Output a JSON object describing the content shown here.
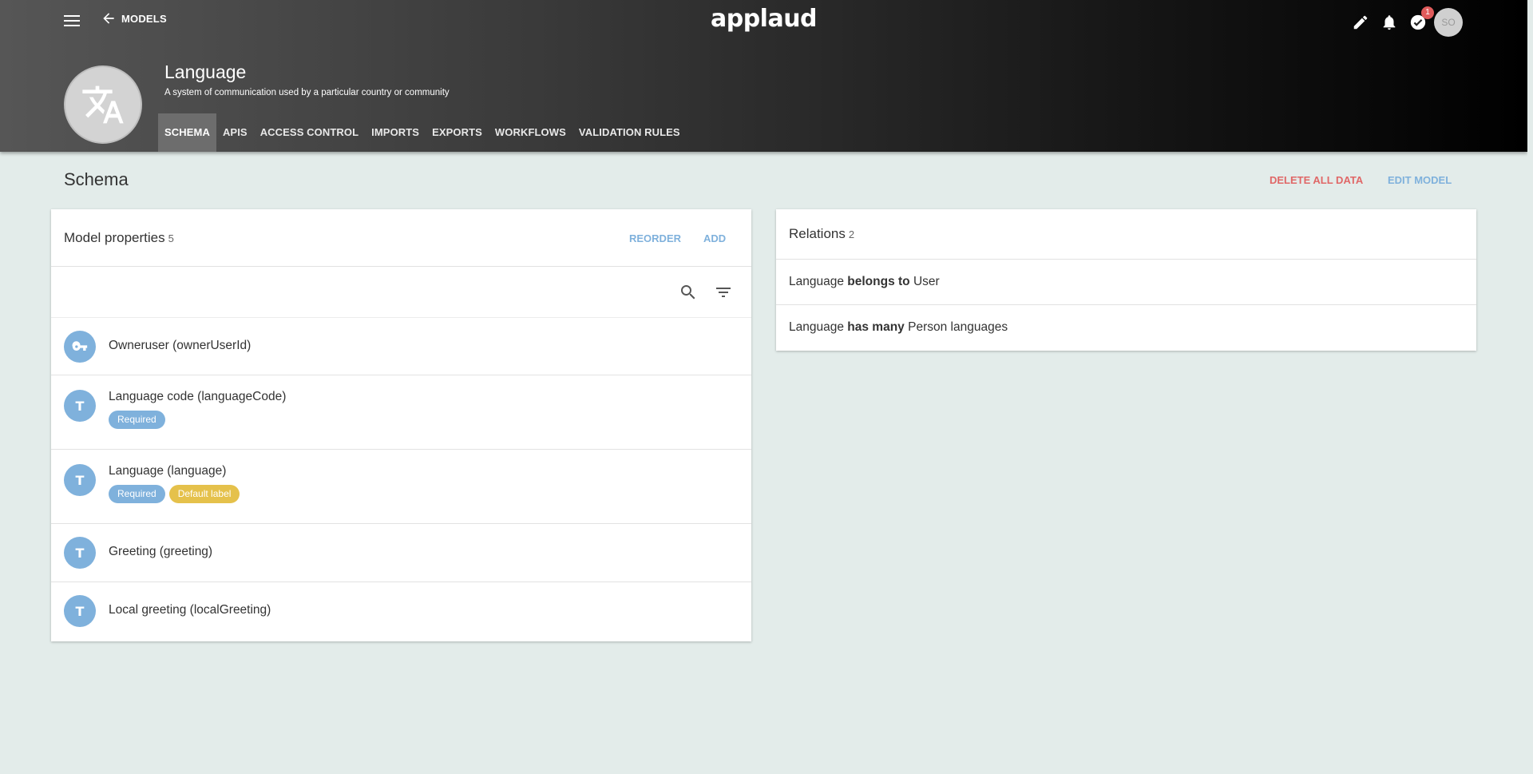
{
  "app": {
    "logo": "applaud",
    "back_label": "MODELS"
  },
  "notifications": {
    "badge_count": "1"
  },
  "user": {
    "initials": "SO"
  },
  "model": {
    "title": "Language",
    "description": "A system of communication used by a particular country or community"
  },
  "tabs": [
    {
      "label": "SCHEMA",
      "active": true
    },
    {
      "label": "APIS"
    },
    {
      "label": "ACCESS CONTROL"
    },
    {
      "label": "IMPORTS"
    },
    {
      "label": "EXPORTS"
    },
    {
      "label": "WORKFLOWS"
    },
    {
      "label": "VALIDATION RULES"
    }
  ],
  "page": {
    "title": "Schema",
    "delete_label": "DELETE ALL DATA",
    "edit_label": "EDIT MODEL"
  },
  "properties": {
    "title": "Model properties",
    "count": "5",
    "reorder_label": "REORDER",
    "add_label": "ADD",
    "items": [
      {
        "name": "Owneruser (ownerUserId)",
        "icon": "key-icon",
        "tags": []
      },
      {
        "name": "Language code (languageCode)",
        "icon": "text-type-icon",
        "tags": [
          "Required"
        ]
      },
      {
        "name": "Language (language)",
        "icon": "text-type-icon",
        "tags": [
          "Required",
          "Default label"
        ]
      },
      {
        "name": "Greeting (greeting)",
        "icon": "text-type-icon",
        "tags": []
      },
      {
        "name": "Local greeting (localGreeting)",
        "icon": "text-type-icon",
        "tags": []
      }
    ],
    "type_glyph": "T",
    "tag_labels": {
      "required": "Required",
      "default": "Default label"
    }
  },
  "relations": {
    "title": "Relations",
    "count": "2",
    "items": [
      {
        "subject": "Language",
        "verb": "belongs to",
        "object": "User"
      },
      {
        "subject": "Language",
        "verb": "has many",
        "object": "Person languages"
      }
    ]
  },
  "colors": {
    "accent": "#7fb1dc",
    "danger": "#e06767",
    "default_tag": "#e5c14b",
    "background": "#e3ecea"
  }
}
